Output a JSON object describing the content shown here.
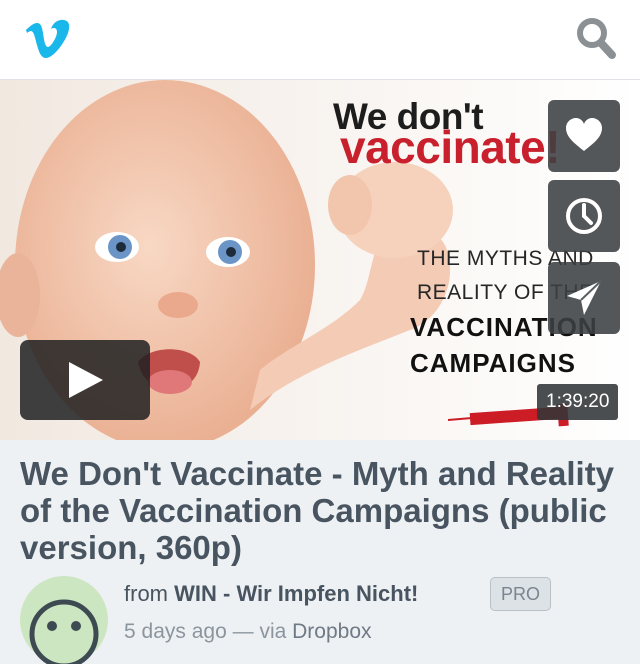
{
  "header": {
    "logo_icon": "vimeo-logo-icon",
    "search_icon": "search-icon",
    "brand_color": "#1ab7ea"
  },
  "video": {
    "thumbnail": {
      "headline_line1": "We don't",
      "headline_line2": "vaccinate!",
      "sub_line1": "THE MYTHS AND",
      "sub_line2": "REALITY OF THE",
      "big_line1": "VACCINATION",
      "big_line2": "CAMPAIGNS"
    },
    "duration": "1:39:20",
    "actions": [
      "heart-icon",
      "clock-icon",
      "send-icon"
    ],
    "play_icon": "play-icon"
  },
  "details": {
    "title": "We Don't Vaccinate - Myth and Reality of the Vaccination Campaigns (public version, 360p)",
    "from_label": "from",
    "owner": "WIN - Wir Impfen Nicht!",
    "badge": "PRO",
    "posted": "5 days ago",
    "separator": "—",
    "via_label": "via",
    "source": "Dropbox"
  }
}
